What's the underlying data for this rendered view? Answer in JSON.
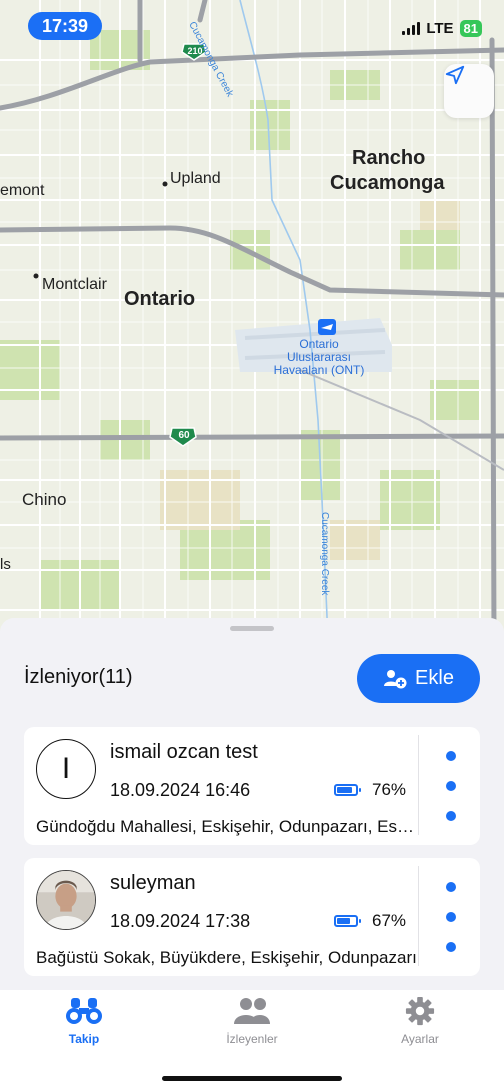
{
  "status_bar": {
    "time": "17:39",
    "network": "LTE",
    "battery": "81"
  },
  "map": {
    "labels": {
      "rancho_cucamonga_line1": "Rancho",
      "rancho_cucamonga_line2": "Cucamonga",
      "upland": "Upland",
      "montclair": "Montclair",
      "ontario": "Ontario",
      "chino": "Chino",
      "emont": "emont",
      "ls": "ls",
      "airport_line1": "Ontario",
      "airport_line2": "Uluslararası",
      "airport_line3": "Havaalanı (ONT)",
      "creek_top": "Cucamonga Creek",
      "creek_bottom": "Cucamonga Creek",
      "hwy_210": "210",
      "hwy_60": "60"
    }
  },
  "sheet": {
    "title": "İzleniyor(11)",
    "add_button_label": "Ekle"
  },
  "people": [
    {
      "initial": "I",
      "name": "ismail ozcan test",
      "datetime": "18.09.2024 16:46",
      "battery": "76%",
      "battery_level": 0.76,
      "address": "Gündoğdu Mahallesi, Eskişehir, Odunpazarı, Eskişehir"
    },
    {
      "initial": "",
      "name": "suleyman",
      "datetime": "18.09.2024 17:38",
      "battery": "67%",
      "battery_level": 0.67,
      "address": "Bağüstü Sokak, Büyükdere, Eskişehir, Odunpazarı"
    }
  ],
  "tabs": [
    {
      "label": "Takip",
      "icon": "binoculars-icon",
      "active": true
    },
    {
      "label": "İzleyenler",
      "icon": "people-icon",
      "active": false
    },
    {
      "label": "Ayarlar",
      "icon": "gear-icon",
      "active": false
    }
  ],
  "colors": {
    "accent": "#1a6ff4",
    "inactive": "#8e8e93",
    "battery_status": "#36c759"
  }
}
